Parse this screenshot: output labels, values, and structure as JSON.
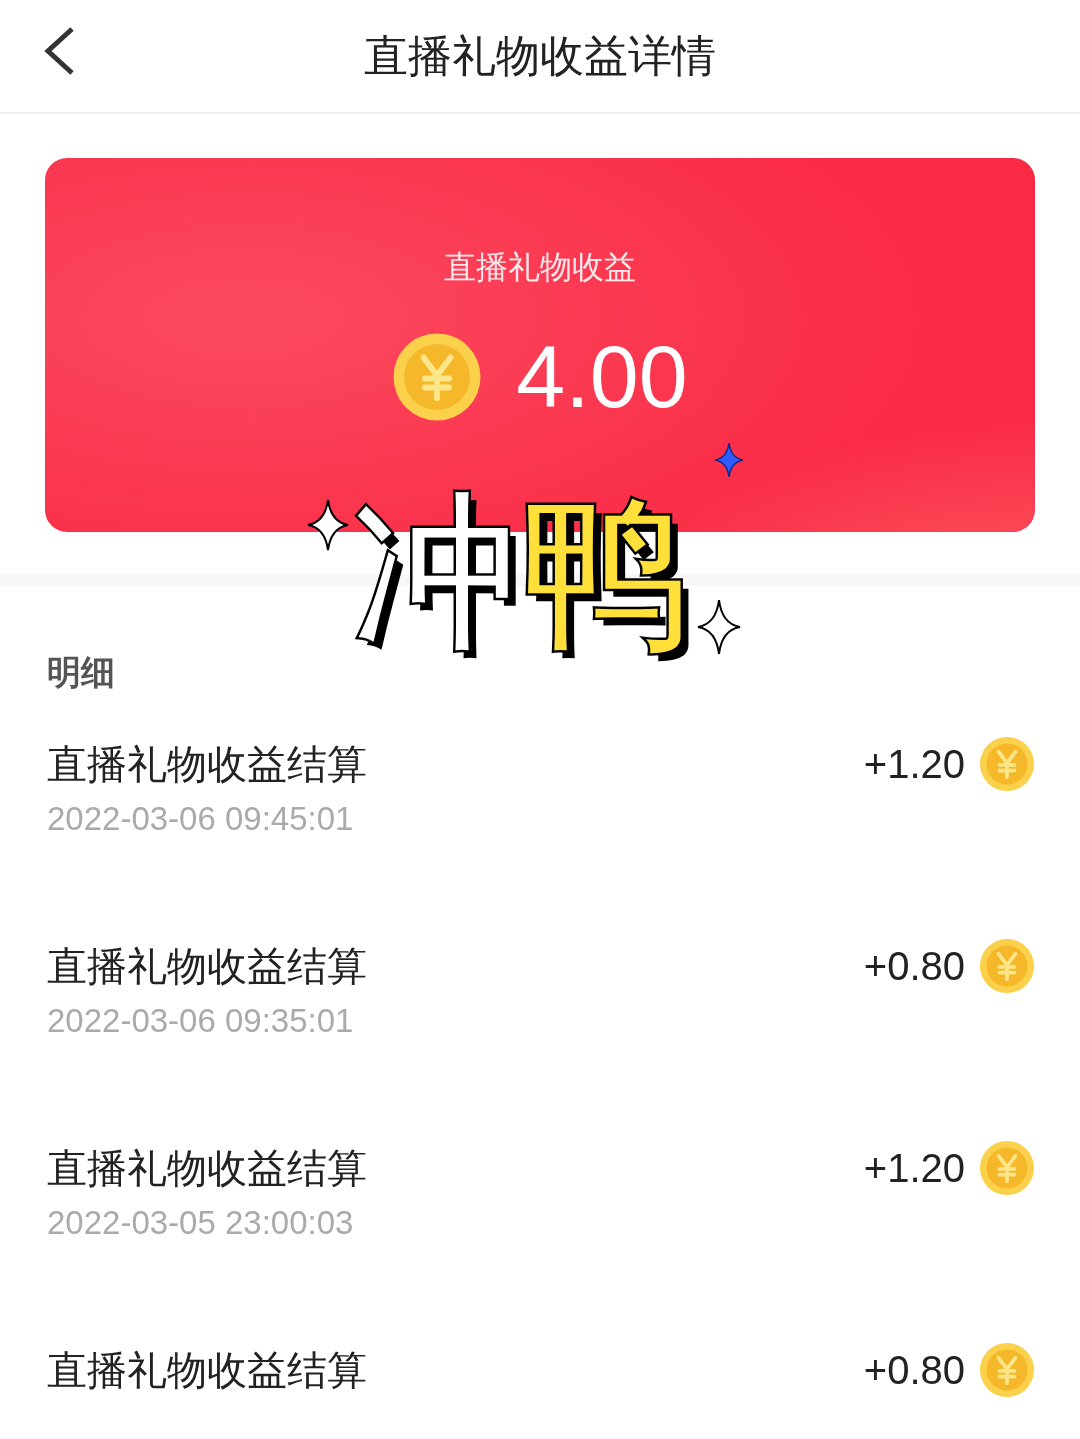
{
  "header": {
    "title": "直播礼物收益详情"
  },
  "summary": {
    "label": "直播礼物收益",
    "amount": "4.00"
  },
  "sticker": {
    "chars": [
      "冲",
      "鸭"
    ]
  },
  "details": {
    "heading": "明细",
    "rows": [
      {
        "title": "直播礼物收益结算",
        "time": "2022-03-06 09:45:01",
        "amount": "+1.20"
      },
      {
        "title": "直播礼物收益结算",
        "time": "2022-03-06 09:35:01",
        "amount": "+0.80"
      },
      {
        "title": "直播礼物收益结算",
        "time": "2022-03-05 23:00:03",
        "amount": "+1.20"
      },
      {
        "title": "直播礼物收益结算",
        "amount": "+0.80"
      }
    ]
  }
}
